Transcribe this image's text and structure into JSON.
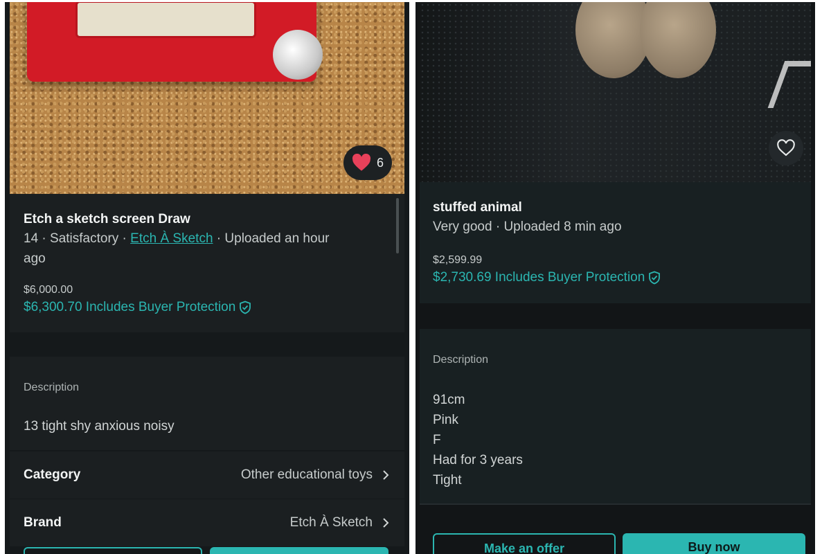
{
  "left": {
    "likes": "6",
    "title": "Etch a sketch screen Draw",
    "meta_prefix": "14 · Satisfactory · ",
    "brand_link": "Etch À Sketch",
    "meta_suffix": " · Uploaded an hour",
    "meta_line2": "ago",
    "price": "$6,000.00",
    "protection_price": "$6,300.70 Includes Buyer Protection",
    "description_label": "Description",
    "description": "13 tight shy anxious noisy",
    "category_label": "Category",
    "category_value": "Other educational toys",
    "brand_label": "Brand",
    "brand_value": "Etch À Sketch"
  },
  "right": {
    "title": "stuffed animal",
    "meta": "Very good · Uploaded 8 min ago",
    "price": "$2,599.99",
    "protection_price": "$2,730.69 Includes Buyer Protection",
    "description_label": "Description",
    "description_lines": [
      "91cm",
      "Pink",
      "F",
      "Had for 3 years",
      "Tight"
    ],
    "make_offer": "Make an offer",
    "buy_now": "Buy now"
  },
  "colors": {
    "accent": "#2bb6b1",
    "like": "#e8415a",
    "background": "#15191b"
  },
  "icons": {
    "like_filled": "heart-filled-icon",
    "like_empty": "heart-outline-icon",
    "protection": "shield-check-icon",
    "chevron": "chevron-right-icon"
  }
}
